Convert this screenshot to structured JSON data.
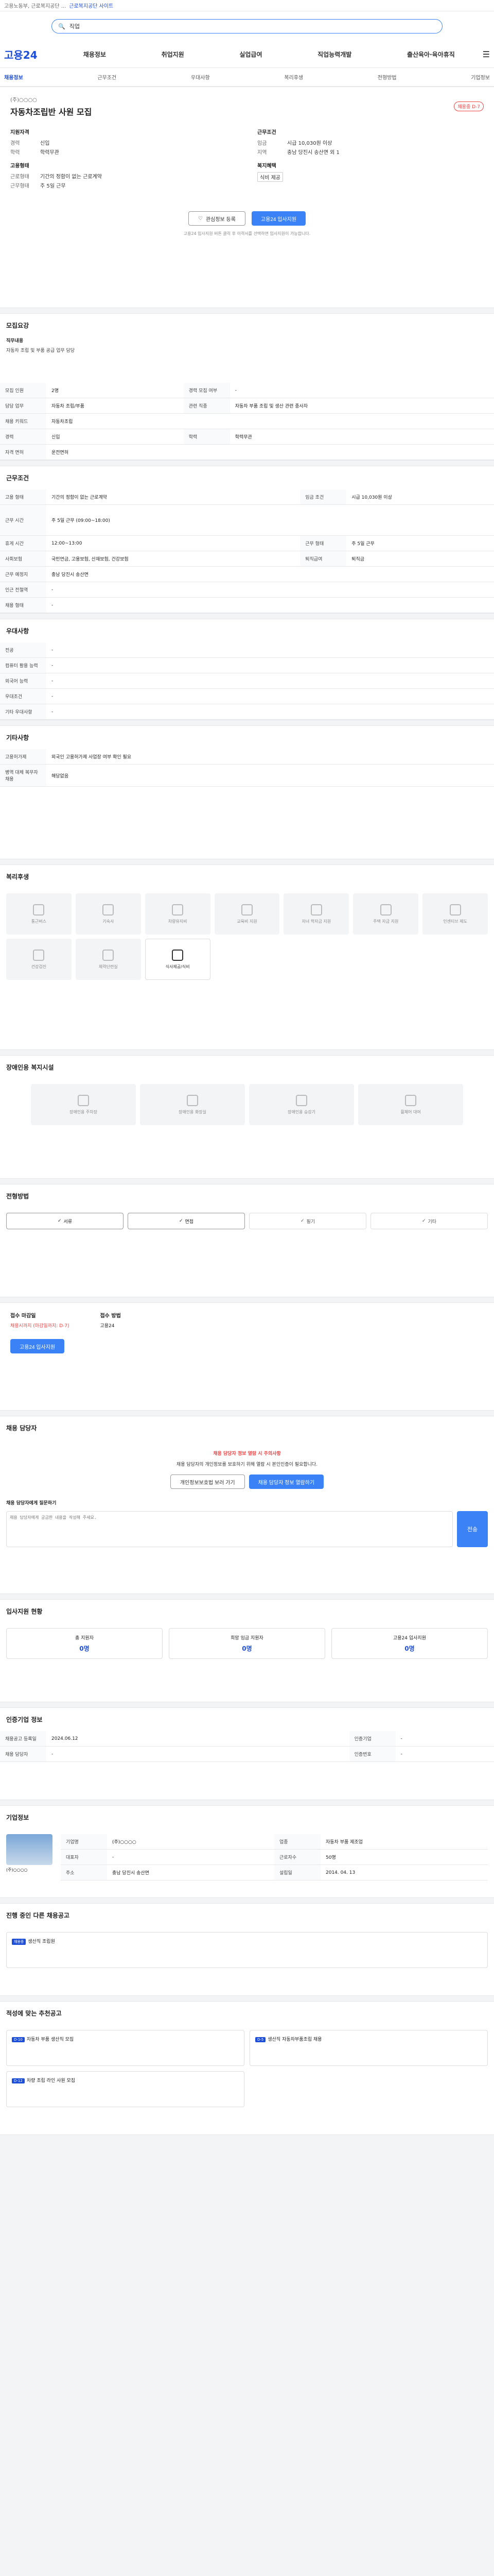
{
  "topbar": {
    "text": "고용노동부, 근로복지공단 ...",
    "link": "근로복지공단 사이트"
  },
  "search": {
    "placeholder": "검색어를 입력해 주세요",
    "value": "직업"
  },
  "header": {
    "logo": "고용24",
    "nav": [
      "채용정보",
      "취업지원",
      "실업급여",
      "직업능력개발",
      "출산육아·육아휴직"
    ]
  },
  "subnav": [
    "채용정보",
    "근무조건",
    "우대사항",
    "복리후생",
    "전형방법",
    "기업정보"
  ],
  "job": {
    "badge": "채용중 D-7",
    "company": "(주)○○○○",
    "title": "자동차조립반 사원 모집",
    "left": {
      "h": "지원자격",
      "rows": [
        [
          "경력",
          "신입"
        ],
        [
          "학력",
          "학력무관"
        ]
      ]
    },
    "right": {
      "h": "근무조건",
      "rows": [
        [
          "임금",
          "시급 10,030원 이상"
        ],
        [
          "지역",
          "충남 당진시 송산면 외 1"
        ]
      ]
    },
    "left2": {
      "h": "고용형태",
      "rows": [
        [
          "근로형태",
          "기간의 정함이 없는 근로계약"
        ],
        [
          "근무형태",
          "주 5일 근무"
        ]
      ]
    },
    "right2": {
      "h": "복지혜택",
      "rows": [
        [
          "",
          "식비 제공"
        ]
      ]
    },
    "btn_save": "관심정보 등록",
    "btn_apply": "고용24 입사지원",
    "note": "고용24 입사지원 버튼 클릭 후 이력서를 선택하면 입사지원이 가능합니다."
  },
  "recruit": {
    "title": "모집요강",
    "desc_h": "직무내용",
    "desc": "자동차 조립 및 부품 공급 업무 담당",
    "rows": [
      [
        "모집 인원",
        "2명",
        "경력 모집 여부",
        "-"
      ],
      [
        "담당 업무",
        "자동차 조립/부품",
        "관련 직종",
        "자동차 부품 조립 및 생산 관련 종사자"
      ],
      [
        "채용 키워드",
        "자동차조립",
        "",
        ""
      ],
      [
        "경력",
        "신입",
        "학력",
        "학력무관"
      ],
      [
        "자격 면허",
        "운전면허",
        "",
        ""
      ]
    ]
  },
  "work": {
    "title": "근무조건",
    "rows": [
      [
        "고용 형태",
        "기간의 정함이 없는 근로계약",
        "임금 조건",
        "시급 10,030원 이상"
      ],
      [
        "근무 시간",
        "주 5일 근무 (09:00~18:00)",
        "",
        ""
      ],
      [
        "휴게 시간",
        "12:00~13:00",
        "근무 형태",
        "주 5일 근무"
      ],
      [
        "사회보험",
        "국민연금, 고용보험, 산재보험, 건강보험",
        "퇴직급여",
        "퇴직금"
      ],
      [
        "근무 예정지",
        "충남 당진시 송산면",
        "",
        ""
      ],
      [
        "인근 전철역",
        "-",
        "",
        ""
      ],
      [
        "채용 형태",
        "-",
        "",
        ""
      ]
    ]
  },
  "prefer": {
    "title": "우대사항",
    "rows": [
      [
        "전공",
        "-"
      ],
      [
        "컴퓨터 활용 능력",
        "-"
      ],
      [
        "외국어 능력",
        "-"
      ],
      [
        "우대조건",
        "-"
      ],
      [
        "기타 우대사항",
        "-"
      ]
    ]
  },
  "etc": {
    "title": "기타사항",
    "rows": [
      [
        "고용허가제",
        "외국인 고용허가제 사업장 여부 확인 필요"
      ],
      [
        "병역 대체 복무자 채용",
        "해당없음"
      ]
    ]
  },
  "benefit": {
    "title": "복리후생",
    "items": [
      "통근버스",
      "기숙사",
      "차량유지비",
      "교육비 지원",
      "자녀 학자금 지원",
      "주택 자금 지원",
      "인센티브 제도",
      "건강검진",
      "체력단련실",
      "식사제공/식비"
    ]
  },
  "disab": {
    "title": "장애인용 복지시설",
    "items": [
      "장애인용 주차장",
      "장애인용 화장실",
      "장애인용 승강기",
      "휠체어 대여"
    ]
  },
  "screen": {
    "title": "전형방법",
    "items": [
      "서류",
      "면접",
      "필기",
      "기타"
    ]
  },
  "apply": {
    "label1": "접수 마감일",
    "val1": "채용시까지 (마감일까지: D-7)",
    "label2": "접수 방법",
    "val2": "고용24",
    "btn": "고용24 입사지원"
  },
  "manager": {
    "title": "채용 담당자",
    "warn": "채용 담당자 정보 열람 시 주의사항",
    "warn_text": "채용 담당자의 개인정보를 보호하기 위해 열람 시 본인인증이 필요합니다.",
    "btn1": "개인정보보호법 보러 가기",
    "btn2": "채용 담당자 정보 열람하기"
  },
  "qa": {
    "title": "채용 담당자에게 질문하기",
    "placeholder": "채용 담당자에게 궁금한 내용을 작성해 주세요.",
    "btn": "전송"
  },
  "status": {
    "title": "입사지원 현황",
    "items": [
      [
        "총 지원자",
        "0명"
      ],
      [
        "희망 임금 지원자",
        "0명"
      ],
      [
        "고용24 입사지원",
        "0명"
      ]
    ]
  },
  "regist": {
    "title": "인증기업 정보",
    "items": [
      [
        "채용공고 등록일",
        "2024.06.12",
        "인증기업",
        "-"
      ],
      [
        "채용 담당자",
        "-",
        "인증번호",
        "-"
      ]
    ]
  },
  "companyinfo": {
    "title": "기업정보",
    "name": "(주)○○○○",
    "rows": [
      [
        "기업명",
        "(주)○○○○",
        "업종",
        "자동차 부품 제조업"
      ],
      [
        "대표자",
        "-",
        "근로자수",
        "50명"
      ],
      [
        "주소",
        "충남 당진시 송산면",
        "설립일",
        "2014. 04. 13"
      ]
    ]
  },
  "related": {
    "title": "진행 중인 다른 채용공고",
    "card": {
      "tag": "채용중",
      "title": "생산직 조립원"
    }
  },
  "ai": {
    "title": "적성에 맞는 추천공고",
    "cards": [
      {
        "tag": "D-10",
        "title": "자동차 부품 생산직 모집"
      },
      {
        "tag": "D-5",
        "title": "생산직 자동차부품조립 채용"
      },
      {
        "tag": "D-12",
        "title": "차량 조립 라인 사원 모집"
      }
    ]
  }
}
